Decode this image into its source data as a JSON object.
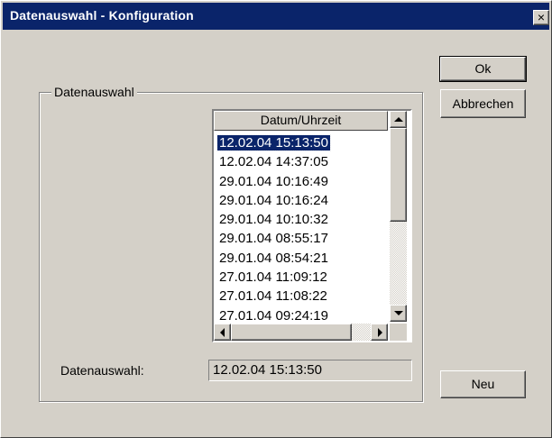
{
  "window": {
    "title": "Datenauswahl - Konfiguration",
    "close_label": "×"
  },
  "buttons": {
    "ok_label": "Ok",
    "cancel_label": "Abbrechen",
    "new_label": "Neu"
  },
  "group": {
    "label": "Datenauswahl"
  },
  "list": {
    "column_header": "Datum/Uhrzeit",
    "items": [
      "12.02.04 15:13:50",
      "12.02.04 14:37:05",
      "29.01.04 10:16:49",
      "29.01.04 10:16:24",
      "29.01.04 10:10:32",
      "29.01.04 08:55:17",
      "29.01.04 08:54:21",
      "27.01.04 11:09:12",
      "27.01.04 11:08:22",
      "27.01.04 09:24:19"
    ],
    "selected_index": 0
  },
  "selection": {
    "label": "Datenauswahl:",
    "value": "12.02.04 15:13:50"
  },
  "colors": {
    "titlebar": "#0a246a",
    "face": "#d4d0c8",
    "selection": "#0a246a"
  }
}
